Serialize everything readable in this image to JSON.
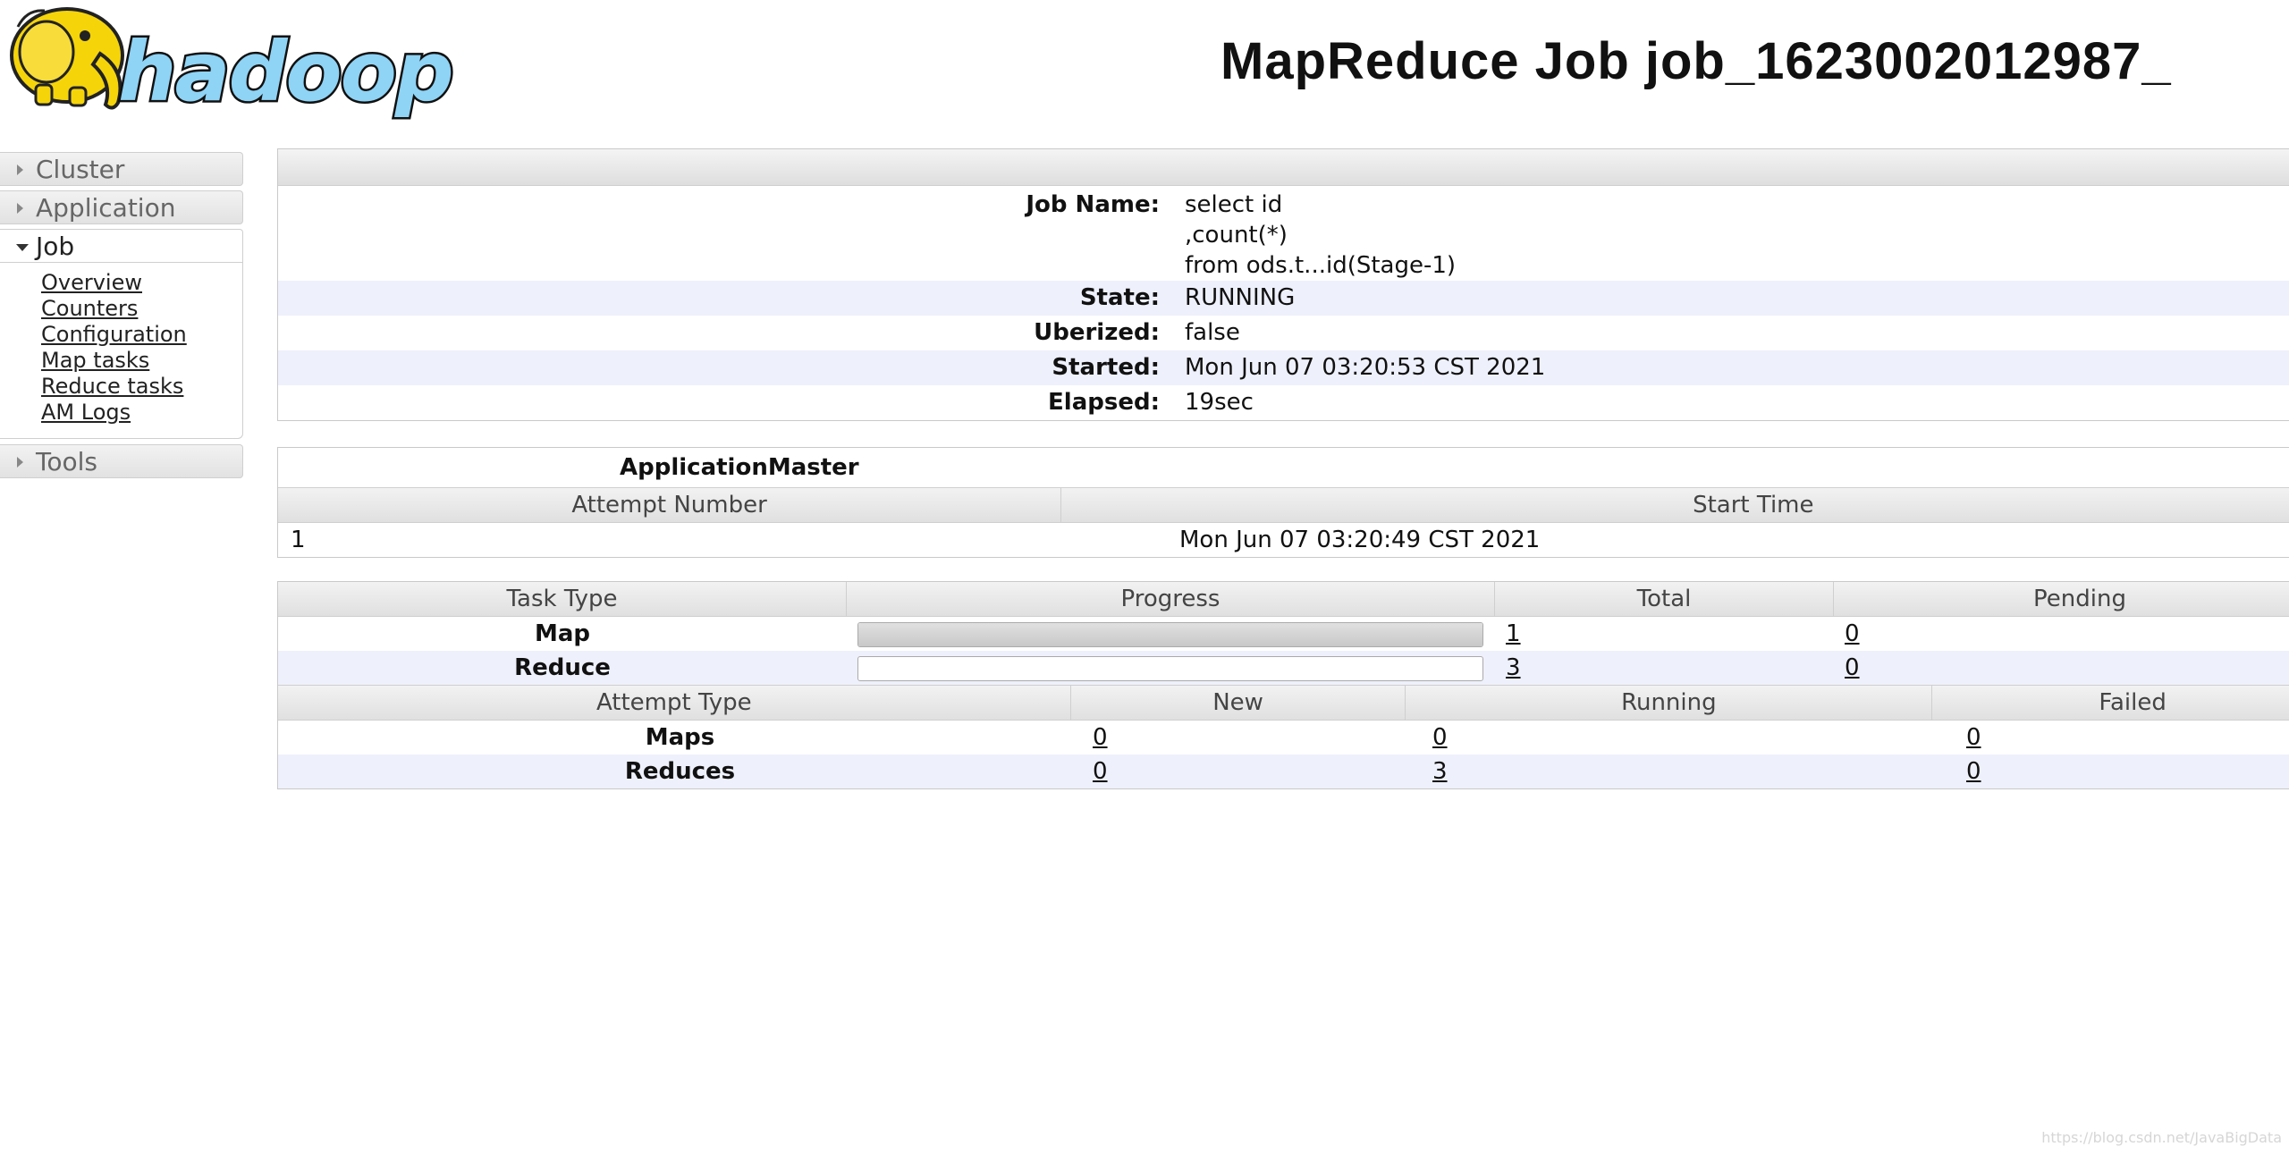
{
  "header": {
    "logo_text": "hadoop",
    "title": "MapReduce Job job_1623002012987_"
  },
  "nav": {
    "sections": [
      {
        "label": "Cluster",
        "open": false
      },
      {
        "label": "Application",
        "open": false
      },
      {
        "label": "Job",
        "open": true
      },
      {
        "label": "Tools",
        "open": false
      }
    ],
    "job_links": [
      "Overview",
      "Counters",
      "Configuration",
      "Map tasks",
      "Reduce tasks",
      "AM Logs"
    ]
  },
  "job_info": {
    "job_name_label": "Job Name:",
    "job_name_lines": [
      "select id",
      ",count(*)",
      "from ods.t...id(Stage-1)"
    ],
    "state_label": "State:",
    "state": "RUNNING",
    "uberized_label": "Uberized:",
    "uberized": "false",
    "started_label": "Started:",
    "started": "Mon Jun 07 03:20:53 CST 2021",
    "elapsed_label": "Elapsed:",
    "elapsed": "19sec"
  },
  "app_master": {
    "title": "ApplicationMaster",
    "headers": [
      "Attempt Number",
      "Start Time"
    ],
    "rows": [
      {
        "attempt": "1",
        "start_time": "Mon Jun 07 03:20:49 CST 2021"
      }
    ]
  },
  "tasks": {
    "headers": [
      "Task Type",
      "Progress",
      "Total",
      "Pending"
    ],
    "rows": [
      {
        "type": "Map",
        "progress": 1.0,
        "total": "1",
        "pending": "0"
      },
      {
        "type": "Reduce",
        "progress": 0.0,
        "total": "3",
        "pending": "0"
      }
    ]
  },
  "attempts": {
    "headers": [
      "Attempt Type",
      "New",
      "Running",
      "Failed"
    ],
    "rows": [
      {
        "type": "Maps",
        "new": "0",
        "running": "0",
        "failed": "0"
      },
      {
        "type": "Reduces",
        "new": "0",
        "running": "3",
        "failed": "0"
      }
    ]
  },
  "watermark": "https://blog.csdn.net/JavaBigData",
  "colors": {
    "row_alt": "#eef0fb",
    "header_band": "#e0e0e0",
    "logo_yellow": "#f5d40a",
    "logo_blue": "#8fd3f5"
  }
}
